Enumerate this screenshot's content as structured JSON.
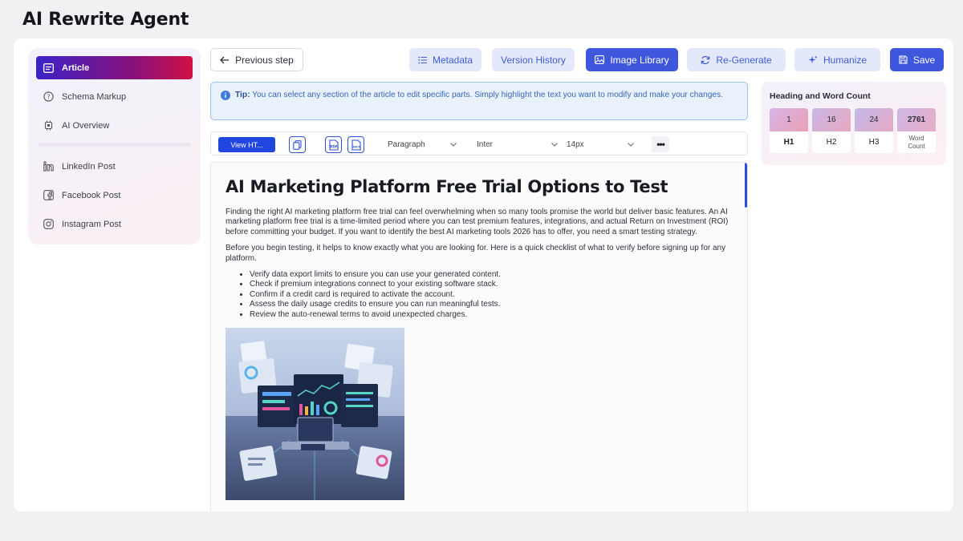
{
  "app": {
    "title": "AI Rewrite Agent"
  },
  "sidebar": {
    "items": [
      {
        "label": "Article",
        "icon": "article-icon",
        "active": true
      },
      {
        "label": "Schema Markup",
        "icon": "help-circle-icon"
      },
      {
        "label": "AI Overview",
        "icon": "chip-icon"
      },
      {
        "label": "LinkedIn Post",
        "icon": "linkedin-icon"
      },
      {
        "label": "Facebook Post",
        "icon": "facebook-icon"
      },
      {
        "label": "Instagram Post",
        "icon": "instagram-icon"
      }
    ]
  },
  "toolbar_top": {
    "previous_step": "Previous step",
    "metadata": "Metadata",
    "version_history": "Version History",
    "image_library": "Image Library",
    "regenerate": "Re-Generate",
    "humanize": "Humanize",
    "save": "Save"
  },
  "tip": {
    "label": "Tip:",
    "text": " You can select any section of the article to edit specific parts. Simply highlight the text you want to modify and make your changes."
  },
  "editor_toolbar": {
    "view_html": "View HT...",
    "block_type": "Paragraph",
    "font": "Inter",
    "size": "14px",
    "more": "•••"
  },
  "article": {
    "title": "AI Marketing Platform Free Trial Options to Test",
    "paragraphs": [
      "Finding the right AI marketing platform free trial can feel overwhelming when so many tools promise the world but deliver basic features. An AI marketing platform free trial is a time-limited period where you can test premium features, integrations, and actual Return on Investment (ROI) before committing your budget. If you want to identify the best AI marketing tools 2026 has to offer, you need a smart testing strategy.",
      "Before you begin testing, it helps to know exactly what you are looking for. Here is a quick checklist of what to verify before signing up for any platform."
    ],
    "checklist": [
      "Verify data export limits to ensure you can use your generated content.",
      "Check if premium integrations connect to your existing software stack.",
      "Confirm if a credit card is required to activate the account.",
      "Assess the daily usage credits to ensure you can run meaningful tests.",
      "Review the auto-renewal terms to avoid unexpected charges."
    ]
  },
  "stats": {
    "title": "Heading and Word Count",
    "items": [
      {
        "value": "1",
        "label": "H1",
        "color": "#e7a9bf"
      },
      {
        "value": "16",
        "label": "H2",
        "color": "#d7b0d8"
      },
      {
        "value": "24",
        "label": "H3",
        "color": "#c9b3e3"
      },
      {
        "value": "2761",
        "label": "Word Count",
        "color": "#d8b6df"
      }
    ]
  },
  "colors": {
    "accent": "#3e57dc",
    "soft_button": "#e3e9fb",
    "active_gradient_start": "#3b22c9",
    "active_gradient_end": "#d11144"
  }
}
